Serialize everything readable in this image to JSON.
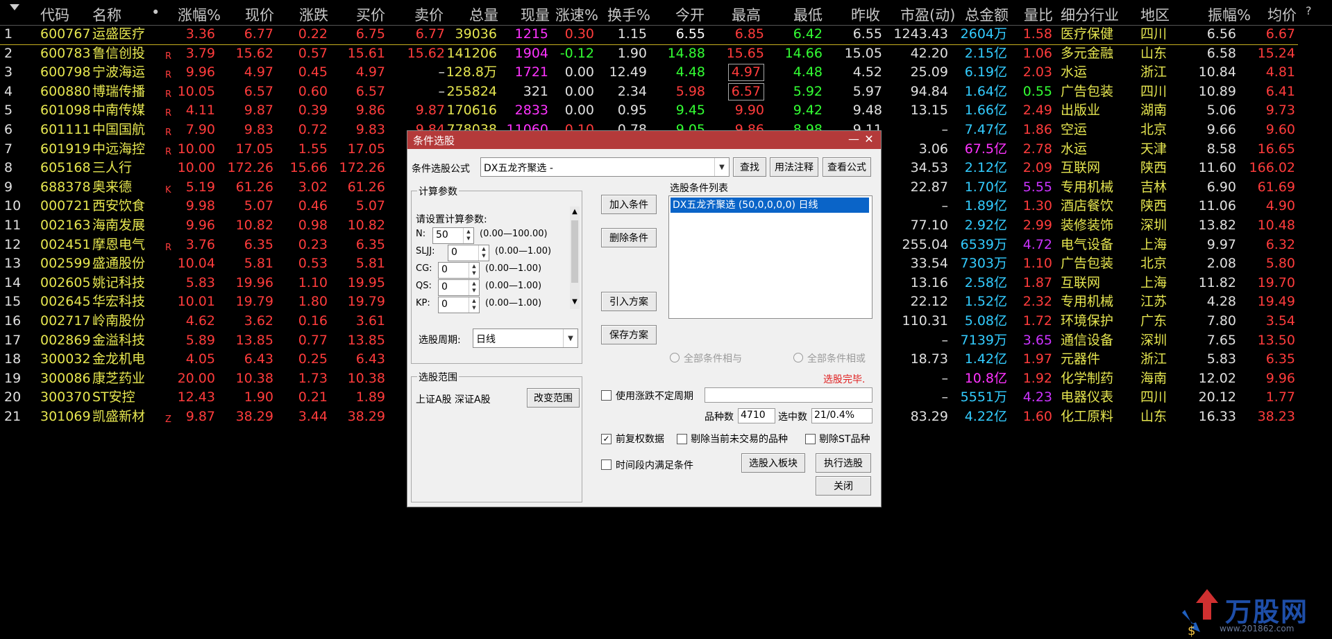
{
  "header": {
    "sort_glyph": "▼",
    "cols": [
      "代码",
      "名称",
      "•",
      "涨幅%",
      "现价",
      "涨跌",
      "买价",
      "卖价",
      "总量",
      "现量",
      "涨速%",
      "换手%",
      "今开",
      "最高",
      "最低",
      "昨收",
      "市盈(动)",
      "总金额",
      "量比",
      "细分行业",
      "地区",
      "振幅%",
      "均价",
      "?"
    ]
  },
  "rows": [
    {
      "n": "1",
      "code": "600767",
      "name": "运盛医疗",
      "flag": "",
      "chg": "3.36",
      "price": "6.77",
      "diff": "0.22",
      "bid": "6.75",
      "ask": "6.77",
      "vol": "39036",
      "cur": "1215",
      "spd": "0.30",
      "turn": "1.15",
      "open": "6.55",
      "high": "6.85",
      "low": "6.42",
      "prev": "6.55",
      "pe": "1243.43",
      "amt": "2604万",
      "vr": "1.58",
      "ind": "医疗保健",
      "reg": "四川",
      "amp": "6.56",
      "avg": "6.67"
    },
    {
      "n": "2",
      "code": "600783",
      "name": "鲁信创投",
      "flag": "R",
      "chg": "3.79",
      "price": "15.62",
      "diff": "0.57",
      "bid": "15.61",
      "ask": "15.62",
      "vol": "141206",
      "cur": "1904",
      "spd": "-0.12",
      "turn": "1.90",
      "open": "14.88",
      "high": "15.65",
      "low": "14.66",
      "prev": "15.05",
      "pe": "42.20",
      "amt": "2.15亿",
      "vr": "1.06",
      "ind": "多元金融",
      "reg": "山东",
      "amp": "6.58",
      "avg": "15.24"
    },
    {
      "n": "3",
      "code": "600798",
      "name": "宁波海运",
      "flag": "R",
      "chg": "9.96",
      "price": "4.97",
      "diff": "0.45",
      "bid": "4.97",
      "ask": "–",
      "vol": "128.8万",
      "cur": "1721",
      "spd": "0.00",
      "turn": "12.49",
      "open": "4.48",
      "high": "4.97",
      "low": "4.48",
      "prev": "4.52",
      "pe": "25.09",
      "amt": "6.19亿",
      "vr": "2.03",
      "ind": "水运",
      "reg": "浙江",
      "amp": "10.84",
      "avg": "4.81"
    },
    {
      "n": "4",
      "code": "600880",
      "name": "博瑞传播",
      "flag": "R",
      "chg": "10.05",
      "price": "6.57",
      "diff": "0.60",
      "bid": "6.57",
      "ask": "–",
      "vol": "255824",
      "cur": "321",
      "spd": "0.00",
      "turn": "2.34",
      "open": "5.98",
      "high": "6.57",
      "low": "5.92",
      "prev": "5.97",
      "pe": "94.84",
      "amt": "1.64亿",
      "vr": "0.55",
      "ind": "广告包装",
      "reg": "四川",
      "amp": "10.89",
      "avg": "6.41"
    },
    {
      "n": "5",
      "code": "601098",
      "name": "中南传媒",
      "flag": "R",
      "chg": "4.11",
      "price": "9.87",
      "diff": "0.39",
      "bid": "9.86",
      "ask": "9.87",
      "vol": "170616",
      "cur": "2833",
      "spd": "0.00",
      "turn": "0.95",
      "open": "9.45",
      "high": "9.90",
      "low": "9.42",
      "prev": "9.48",
      "pe": "13.15",
      "amt": "1.66亿",
      "vr": "2.49",
      "ind": "出版业",
      "reg": "湖南",
      "amp": "5.06",
      "avg": "9.73"
    },
    {
      "n": "6",
      "code": "601111",
      "name": "中国国航",
      "flag": "R",
      "chg": "7.90",
      "price": "9.83",
      "diff": "0.72",
      "bid": "9.83",
      "ask": "9.84",
      "vol": "778038",
      "cur": "11060",
      "spd": "0.10",
      "turn": "0.78",
      "open": "9.05",
      "high": "9.86",
      "low": "8.98",
      "prev": "9.11",
      "pe": "–",
      "amt": "7.47亿",
      "vr": "1.86",
      "ind": "空运",
      "reg": "北京",
      "amp": "9.66",
      "avg": "9.60"
    },
    {
      "n": "7",
      "code": "601919",
      "name": "中远海控",
      "flag": "R",
      "chg": "10.00",
      "price": "17.05",
      "diff": "1.55",
      "bid": "17.05",
      "pe": "3.06",
      "amt": "67.5亿",
      "vr": "2.78",
      "ind": "水运",
      "reg": "天津",
      "amp": "8.58",
      "avg": "16.65"
    },
    {
      "n": "8",
      "code": "605168",
      "name": "三人行",
      "flag": "",
      "chg": "10.00",
      "price": "172.26",
      "diff": "15.66",
      "bid": "172.26",
      "pe": "34.53",
      "amt": "2.12亿",
      "vr": "2.09",
      "ind": "互联网",
      "reg": "陕西",
      "amp": "11.60",
      "avg": "166.02"
    },
    {
      "n": "9",
      "code": "688378",
      "name": "奥来德",
      "flag": "K",
      "chg": "5.19",
      "price": "61.26",
      "diff": "3.02",
      "bid": "61.26",
      "pe": "22.87",
      "amt": "1.70亿",
      "vr": "5.55",
      "ind": "专用机械",
      "reg": "吉林",
      "amp": "6.90",
      "avg": "61.69"
    },
    {
      "n": "10",
      "code": "000721",
      "name": "西安饮食",
      "flag": "",
      "chg": "9.98",
      "price": "5.07",
      "diff": "0.46",
      "bid": "5.07",
      "pe": "–",
      "amt": "1.89亿",
      "vr": "1.30",
      "ind": "酒店餐饮",
      "reg": "陕西",
      "amp": "11.06",
      "avg": "4.90"
    },
    {
      "n": "11",
      "code": "002163",
      "name": "海南发展",
      "flag": "",
      "chg": "9.96",
      "price": "10.82",
      "diff": "0.98",
      "bid": "10.82",
      "pe": "77.10",
      "amt": "2.92亿",
      "vr": "2.99",
      "ind": "装修装饰",
      "reg": "深圳",
      "amp": "13.82",
      "avg": "10.48"
    },
    {
      "n": "12",
      "code": "002451",
      "name": "摩恩电气",
      "flag": "R",
      "chg": "3.76",
      "price": "6.35",
      "diff": "0.23",
      "bid": "6.35",
      "pe": "255.04",
      "amt": "6539万",
      "vr": "4.72",
      "ind": "电气设备",
      "reg": "上海",
      "amp": "9.97",
      "avg": "6.32"
    },
    {
      "n": "13",
      "code": "002599",
      "name": "盛通股份",
      "flag": "",
      "chg": "10.04",
      "price": "5.81",
      "diff": "0.53",
      "bid": "5.81",
      "pe": "33.54",
      "amt": "7303万",
      "vr": "1.10",
      "ind": "广告包装",
      "reg": "北京",
      "amp": "2.08",
      "avg": "5.80"
    },
    {
      "n": "14",
      "code": "002605",
      "name": "姚记科技",
      "flag": "",
      "chg": "5.83",
      "price": "19.96",
      "diff": "1.10",
      "bid": "19.95",
      "pe": "13.16",
      "amt": "2.58亿",
      "vr": "1.87",
      "ind": "互联网",
      "reg": "上海",
      "amp": "11.82",
      "avg": "19.70"
    },
    {
      "n": "15",
      "code": "002645",
      "name": "华宏科技",
      "flag": "",
      "chg": "10.01",
      "price": "19.79",
      "diff": "1.80",
      "bid": "19.79",
      "pe": "22.12",
      "amt": "1.52亿",
      "vr": "2.32",
      "ind": "专用机械",
      "reg": "江苏",
      "amp": "4.28",
      "avg": "19.49"
    },
    {
      "n": "16",
      "code": "002717",
      "name": "岭南股份",
      "flag": "",
      "chg": "4.62",
      "price": "3.62",
      "diff": "0.16",
      "bid": "3.61",
      "pe": "110.31",
      "amt": "5.08亿",
      "vr": "1.72",
      "ind": "环境保护",
      "reg": "广东",
      "amp": "7.80",
      "avg": "3.54"
    },
    {
      "n": "17",
      "code": "002869",
      "name": "金溢科技",
      "flag": "",
      "chg": "5.89",
      "price": "13.85",
      "diff": "0.77",
      "bid": "13.85",
      "pe": "–",
      "amt": "7139万",
      "vr": "3.65",
      "ind": "通信设备",
      "reg": "深圳",
      "amp": "7.65",
      "avg": "13.50"
    },
    {
      "n": "18",
      "code": "300032",
      "name": "金龙机电",
      "flag": "",
      "chg": "4.05",
      "price": "6.43",
      "diff": "0.25",
      "bid": "6.43",
      "pe": "18.73",
      "amt": "1.42亿",
      "vr": "1.97",
      "ind": "元器件",
      "reg": "浙江",
      "amp": "5.83",
      "avg": "6.35"
    },
    {
      "n": "19",
      "code": "300086",
      "name": "康芝药业",
      "flag": "",
      "chg": "20.00",
      "price": "10.38",
      "diff": "1.73",
      "bid": "10.38",
      "pe": "–",
      "amt": "10.8亿",
      "vr": "1.92",
      "ind": "化学制药",
      "reg": "海南",
      "amp": "12.02",
      "avg": "9.96"
    },
    {
      "n": "20",
      "code": "300370",
      "name": "ST安控",
      "flag": "",
      "chg": "12.43",
      "price": "1.90",
      "diff": "0.21",
      "bid": "1.89",
      "pe": "–",
      "amt": "5551万",
      "vr": "4.23",
      "ind": "电器仪表",
      "reg": "四川",
      "amp": "20.12",
      "avg": "1.77"
    },
    {
      "n": "21",
      "code": "301069",
      "name": "凯盛新材",
      "flag": "Z",
      "chg": "9.87",
      "price": "38.29",
      "diff": "3.44",
      "bid": "38.29",
      "pe": "83.29",
      "amt": "4.22亿",
      "vr": "1.60",
      "ind": "化工原料",
      "reg": "山东",
      "amp": "16.33",
      "avg": "38.23"
    }
  ],
  "dialog": {
    "title": "条件选股",
    "minimize": "—",
    "close": "✕",
    "formula_label": "条件选股公式",
    "formula_value": "DX五龙齐聚选 -",
    "btn_find": "查找",
    "btn_usage": "用法注释",
    "btn_view": "查看公式",
    "params_group": "计算参数",
    "params_prompt": "请设置计算参数:",
    "params": [
      {
        "name": "N:",
        "value": "50",
        "range": "(0.00—100.00)"
      },
      {
        "name": "SLJJ:",
        "value": "0",
        "range": "(0.00—1.00)"
      },
      {
        "name": "CG:",
        "value": "0",
        "range": "(0.00—1.00)"
      },
      {
        "name": "QS:",
        "value": "0",
        "range": "(0.00—1.00)"
      },
      {
        "name": "KP:",
        "value": "0",
        "range": "(0.00—1.00)"
      }
    ],
    "period_label": "选股周期:",
    "period_value": "日线",
    "btn_add": "加入条件",
    "btn_delete": "删除条件",
    "btn_import": "引入方案",
    "btn_save": "保存方案",
    "list_label": "选股条件列表",
    "list_items": [
      "DX五龙齐聚选 (50,0,0,0,0) 日线"
    ],
    "radio_and": "全部条件相与",
    "radio_or": "全部条件相或",
    "status": "选股完毕.",
    "range_group": "选股范围",
    "range_value": "上证A股 深证A股",
    "btn_change_range": "改变范围",
    "chk_period": "使用涨跌不定周期",
    "count_label": "品种数",
    "count_value": "4710",
    "selected_label": "选中数",
    "selected_value": "21/0.4%",
    "chk_rights": "前复权数据",
    "chk_remove_untraded": "剔除当前未交易的品种",
    "chk_remove_st": "剔除ST品种",
    "chk_time": "时间段内满足条件",
    "btn_to_block": "选股入板块",
    "btn_execute": "执行选股",
    "btn_close": "关闭"
  },
  "watermark": {
    "brand": "万股网",
    "url": "www.201862.com"
  },
  "colors": {
    "up": "#ff3c3c",
    "down": "#33ff33",
    "neutral": "#e0e0e0",
    "code": "#e6e650",
    "name": "#e6e650",
    "amount": "#33ccff",
    "volume": "#e6e650",
    "current_vol": "#ff33ff",
    "header": "#c8c8c8",
    "title_bar": "#b43a3a"
  }
}
